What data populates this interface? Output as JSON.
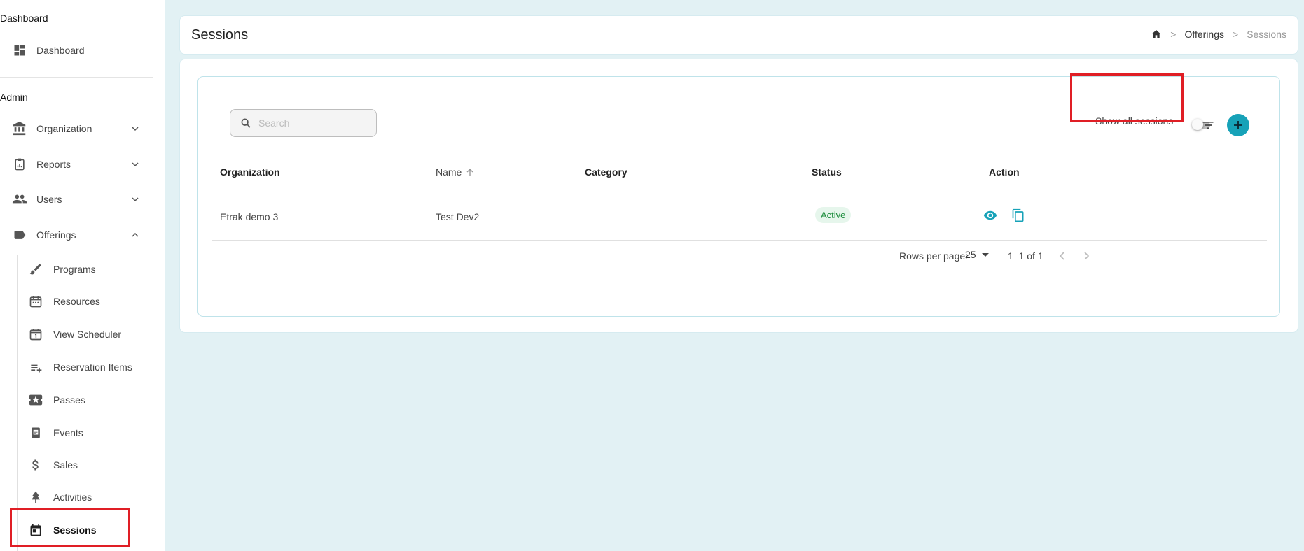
{
  "sidebar": {
    "dashboard_section": "Dashboard",
    "dashboard_item": "Dashboard",
    "admin_section": "Admin",
    "groups": [
      {
        "label": "Organization",
        "icon": "bank-icon"
      },
      {
        "label": "Reports",
        "icon": "clipboard-icon"
      },
      {
        "label": "Users",
        "icon": "people-icon"
      },
      {
        "label": "Offerings",
        "icon": "tag-icon"
      }
    ],
    "sub_items": [
      {
        "label": "Programs",
        "icon": "brush-icon"
      },
      {
        "label": "Resources",
        "icon": "calendar-dots-icon"
      },
      {
        "label": "View Scheduler",
        "icon": "calendar-one-icon"
      },
      {
        "label": "Reservation Items",
        "icon": "playlist-add-icon"
      },
      {
        "label": "Passes",
        "icon": "ticket-star-icon"
      },
      {
        "label": "Events",
        "icon": "event-note-icon"
      },
      {
        "label": "Sales",
        "icon": "dollar-icon"
      },
      {
        "label": "Activities",
        "icon": "tree-icon"
      },
      {
        "label": "Sessions",
        "icon": "calendar-icon"
      }
    ]
  },
  "header": {
    "title": "Sessions",
    "breadcrumb": {
      "home_icon": "home-icon",
      "offerings": "Offerings",
      "current": "Sessions"
    }
  },
  "toolbar": {
    "search_placeholder": "Search",
    "show_all_label": "Show all sessions",
    "show_all_on": false
  },
  "table": {
    "columns": [
      "Organization",
      "Name",
      "Category",
      "Status",
      "Action"
    ],
    "sort_column": "Name",
    "sort_direction": "asc",
    "rows": [
      {
        "organization": "Etrak demo 3",
        "name": "Test Dev2",
        "category": "",
        "status": "Active"
      }
    ]
  },
  "pagination": {
    "rows_per_page_label": "Rows per page:",
    "rows_per_page": "25",
    "range": "1–1 of 1"
  },
  "colors": {
    "accent": "#17a2b8",
    "main_bg": "#e2f1f4",
    "active_status_bg": "#e6f6ec",
    "active_status_text": "#1e8e3e",
    "highlight": "#e01e25"
  }
}
